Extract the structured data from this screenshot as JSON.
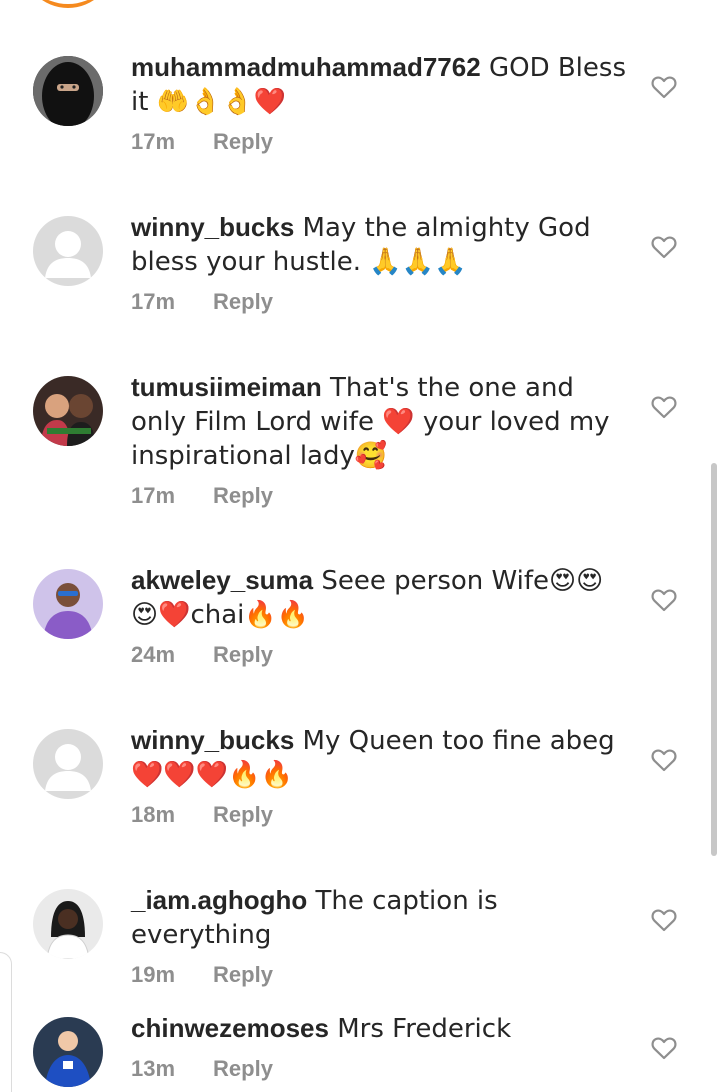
{
  "comments": [
    {
      "user": "muhammadmuhammad7762",
      "text": " GOD Bless it 🤲👌👌❤️",
      "time": "17m",
      "reply": "Reply",
      "avatar": "hijab"
    },
    {
      "user": "winny_bucks",
      "text": " May the almighty God bless your hustle. 🙏🙏🙏",
      "time": "17m",
      "reply": "Reply",
      "avatar": "default"
    },
    {
      "user": "tumusiimeiman",
      "text": " That's the one and only Film Lord wife ❤️ your loved my inspirational lady🥰",
      "time": "17m",
      "reply": "Reply",
      "avatar": "couple"
    },
    {
      "user": "akweley_suma",
      "text": " Seee person Wife😍😍😍❤️chai🔥🔥",
      "time": "24m",
      "reply": "Reply",
      "avatar": "woman-purple"
    },
    {
      "user": "winny_bucks",
      "text": " My Queen too fine abeg❤️❤️❤️🔥🔥",
      "time": "18m",
      "reply": "Reply",
      "avatar": "default"
    },
    {
      "user": "_iam.aghogho",
      "text": " The caption is everything",
      "time": "19m",
      "reply": "Reply",
      "avatar": "woman-dark"
    },
    {
      "user": "chinwezemoses",
      "text": " Mrs Frederick",
      "time": "13m",
      "reply": "Reply",
      "avatar": "footballer"
    }
  ],
  "colors": {
    "text": "#262626",
    "meta": "#8e8e8e",
    "accent": "#f58a1f"
  },
  "icons": {
    "like": "heart-outline-icon"
  }
}
